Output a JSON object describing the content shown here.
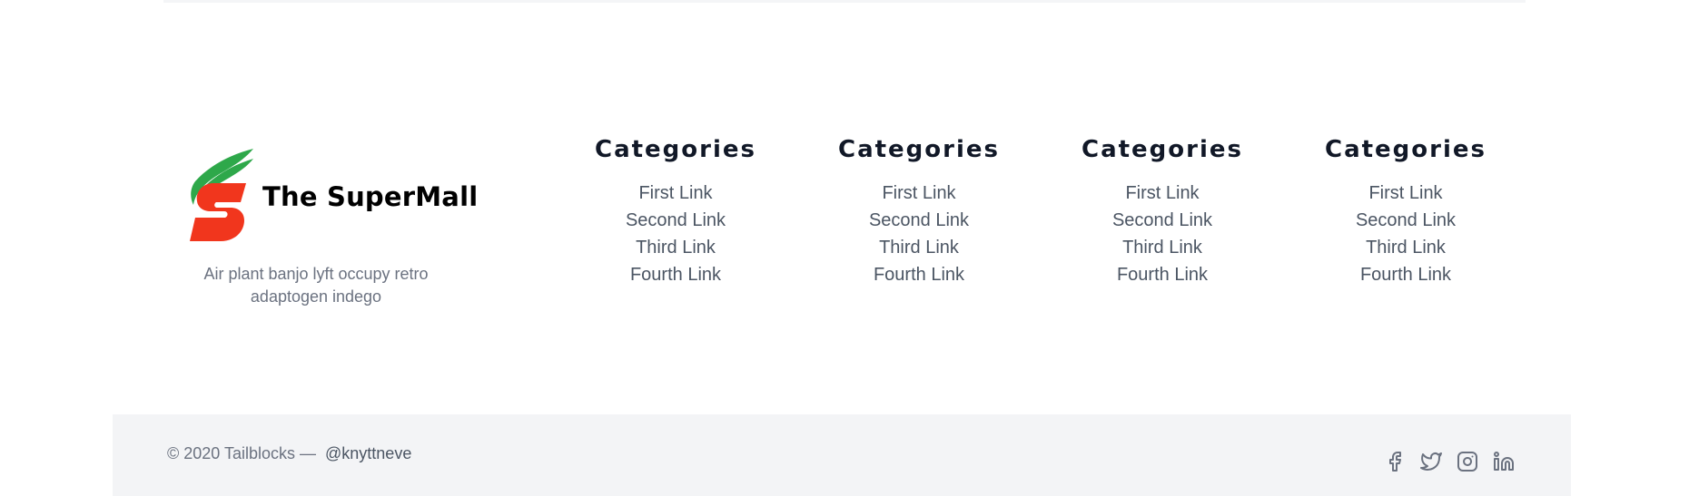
{
  "brand": {
    "name": "The SuperMall",
    "description": "Air plant banjo lyft occupy retro adaptogen indego",
    "logo_colors": {
      "green": "#2ea84a",
      "red": "#f1361d"
    }
  },
  "columns": [
    {
      "title": "Categories",
      "links": [
        "First Link",
        "Second Link",
        "Third Link",
        "Fourth Link"
      ]
    },
    {
      "title": "Categories",
      "links": [
        "First Link",
        "Second Link",
        "Third Link",
        "Fourth Link"
      ]
    },
    {
      "title": "Categories",
      "links": [
        "First Link",
        "Second Link",
        "Third Link",
        "Fourth Link"
      ]
    },
    {
      "title": "Categories",
      "links": [
        "First Link",
        "Second Link",
        "Third Link",
        "Fourth Link"
      ]
    }
  ],
  "footer": {
    "copyright": "© 2020 Tailblocks —",
    "handle": "@knyttneve",
    "social_icons": [
      "facebook-icon",
      "twitter-icon",
      "instagram-icon",
      "linkedin-icon"
    ],
    "icon_color": "#6b7280",
    "bar_color": "#f3f4f6"
  }
}
